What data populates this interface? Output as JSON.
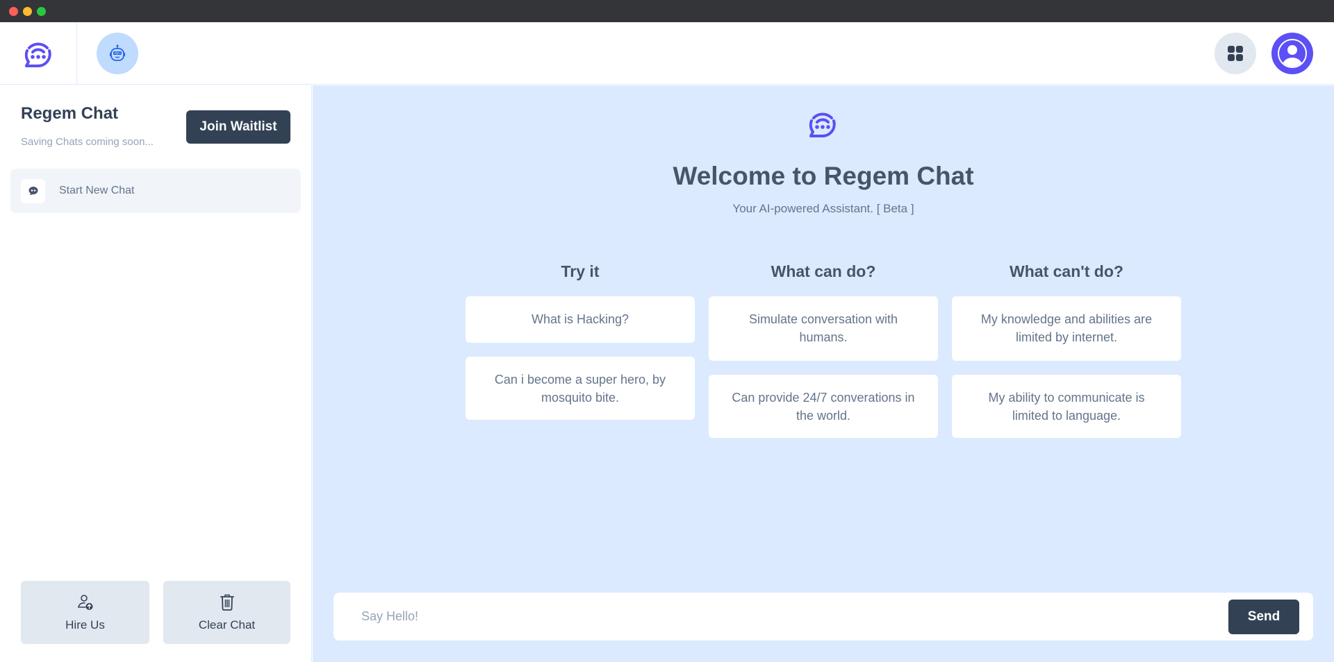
{
  "window": {
    "controls": [
      "close",
      "minimize",
      "maximize"
    ]
  },
  "header": {
    "logo_icon": "chat-bubble-logo-icon",
    "bot_icon": "robot-icon",
    "apps_icon": "grid-icon",
    "profile_icon": "user-circle-icon"
  },
  "sidebar": {
    "title": "Regem Chat",
    "subtitle": "Saving Chats coming soon...",
    "join_label": "Join Waitlist",
    "new_chat_label": "Start New Chat",
    "new_chat_icon": "chat-icon",
    "hire_label": "Hire Us",
    "hire_icon": "user-upload-icon",
    "clear_label": "Clear Chat",
    "clear_icon": "trash-icon"
  },
  "main": {
    "title": "Welcome to Regem Chat",
    "tagline": "Your AI-powered Assistant. [ Beta ]",
    "columns": [
      {
        "heading": "Try it",
        "cards": [
          "What is Hacking?",
          "Can i become a super hero, by mosquito bite."
        ]
      },
      {
        "heading": "What can do?",
        "cards": [
          "Simulate conversation with humans.",
          "Can provide 24/7 converations in the world."
        ]
      },
      {
        "heading": "What can't do?",
        "cards": [
          "My knowledge and abilities are limited by internet.",
          "My ability to communicate is limited to language."
        ]
      }
    ],
    "input_placeholder": "Say Hello!",
    "input_value": "",
    "send_label": "Send"
  },
  "colors": {
    "brand": "#5b4ff5",
    "dark_button": "#334155",
    "main_bg": "#dbeafe",
    "bot_bg": "#bfdbfe"
  }
}
